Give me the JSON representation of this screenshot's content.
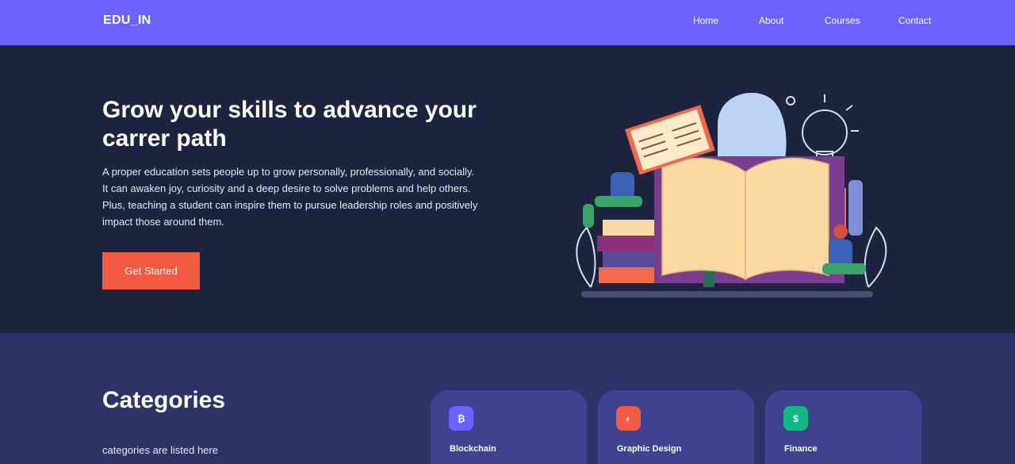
{
  "nav": {
    "brand": "EDU_IN",
    "links": [
      "Home",
      "About",
      "Courses",
      "Contact"
    ],
    "color": "#6c63ff"
  },
  "hero": {
    "title": "Grow your skills to advance your carrer path",
    "text": "A proper education sets people up to grow personally, professionally, and socially. It can awaken joy, curiosity and a deep desire to solve problems and help others. Plus, teaching a student can inspire them to pursue leadership roles and positively impact those around them.",
    "cta_label": "Get Started",
    "cta_color": "#f25a41",
    "background": "#1e2440",
    "illustration_icon": "education-books-illustration"
  },
  "categories": {
    "title": "Categories",
    "subtitle": "categories are listed here",
    "background": "#2e3267",
    "items": [
      {
        "label": "Blockchain",
        "icon": "blockchain-icon",
        "icon_glyph": "₿",
        "color": "#6c63ff"
      },
      {
        "label": "Graphic Design",
        "icon": "palette-icon",
        "icon_glyph": "◐",
        "color": "#f25a41"
      },
      {
        "label": "Finance",
        "icon": "dollar-icon",
        "icon_glyph": "$",
        "color": "#12b886"
      }
    ]
  }
}
